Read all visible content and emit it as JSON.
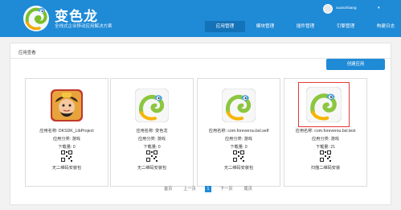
{
  "header": {
    "brand_title": "变色龙",
    "brand_subtitle": "全线式企业移动应用解决方案",
    "user_name": "xuanzhiiang",
    "nav": [
      {
        "label": "应用管理",
        "active": true
      },
      {
        "label": "模块管理",
        "active": false
      },
      {
        "label": "插件管理",
        "active": false
      },
      {
        "label": "引擎管理",
        "active": false
      },
      {
        "label": "构建日志",
        "active": false
      }
    ],
    "colors": {
      "header_bg": "#1f8ad6",
      "nav_active": "#1372b8",
      "selected_border": "#e53935"
    }
  },
  "panel": {
    "title": "应用查看",
    "create_button": "创建应用"
  },
  "apps": [
    {
      "name": "应用名称: DKSDK_LibProject",
      "category": "应用分类: 游戏",
      "downloads": "下载量: 0",
      "qr_label": "无二维码安装包",
      "icon": "warrior-game-icon",
      "selected": false
    },
    {
      "name": "应用名称: 变色龙",
      "category": "应用分类: 游戏",
      "downloads": "下载量: 0",
      "qr_label": "无二维码安装包",
      "icon": "chameleon-icon",
      "selected": false
    },
    {
      "name": "应用名称: com.foreverou.bsl.self",
      "category": "应用分类: 游戏",
      "downloads": "下载量: 0",
      "qr_label": "无二维码安装包",
      "icon": "chameleon-icon",
      "selected": false
    },
    {
      "name": "应用名称: com.foreverou.bsl.test",
      "category": "应用分类: 游戏",
      "downloads": "下载量: 21",
      "qr_label": "扫描二维码安装",
      "icon": "chameleon-icon",
      "selected": true
    }
  ],
  "pagination": {
    "first": "首页",
    "prev": "上一页",
    "current": "1",
    "next": "下一页",
    "last": "尾页"
  }
}
